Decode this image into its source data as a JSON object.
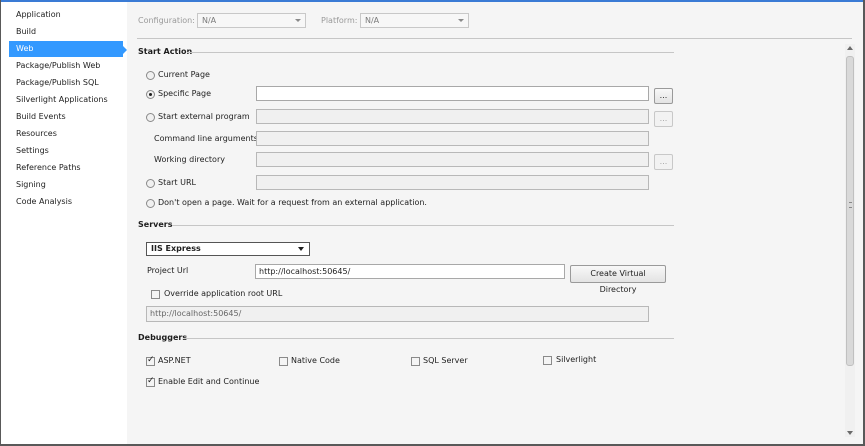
{
  "sidebar": {
    "items": [
      {
        "label": "Application",
        "active": false
      },
      {
        "label": "Build",
        "active": false
      },
      {
        "label": "Web",
        "active": true
      },
      {
        "label": "Package/Publish Web",
        "active": false
      },
      {
        "label": "Package/Publish SQL",
        "active": false
      },
      {
        "label": "Silverlight Applications",
        "active": false
      },
      {
        "label": "Build Events",
        "active": false
      },
      {
        "label": "Resources",
        "active": false
      },
      {
        "label": "Settings",
        "active": false
      },
      {
        "label": "Reference Paths",
        "active": false
      },
      {
        "label": "Signing",
        "active": false
      },
      {
        "label": "Code Analysis",
        "active": false
      }
    ]
  },
  "toolbar": {
    "configuration_label": "Configuration:",
    "configuration_value": "N/A",
    "platform_label": "Platform:",
    "platform_value": "N/A"
  },
  "start_action": {
    "heading": "Start Action",
    "current_page": "Current Page",
    "specific_page": "Specific Page",
    "specific_page_value": "",
    "browse_label": "...",
    "start_external_program": "Start external program",
    "command_line_arguments": "Command line arguments",
    "working_directory": "Working directory",
    "start_url": "Start URL",
    "dont_open": "Don't open a page.  Wait for a request from an external application.",
    "selected": "specific_page"
  },
  "servers": {
    "heading": "Servers",
    "server_value": "IIS Express",
    "project_url_label": "Project Url",
    "project_url_value": "http://localhost:50645/",
    "create_virtual_directory": "Create Virtual Directory",
    "override_label": "Override application root URL",
    "override_checked": false,
    "override_value": "http://localhost:50645/"
  },
  "debuggers": {
    "heading": "Debuggers",
    "aspnet": "ASP.NET",
    "aspnet_checked": true,
    "native_code": "Native Code",
    "native_checked": false,
    "sql_server": "SQL Server",
    "sql_checked": false,
    "silverlight": "Silverlight",
    "silverlight_checked": false,
    "enable_edit_continue": "Enable Edit and Continue",
    "edit_continue_checked": true
  },
  "colors": {
    "accent": "#3399ff",
    "top_border": "#3a7bd5"
  }
}
